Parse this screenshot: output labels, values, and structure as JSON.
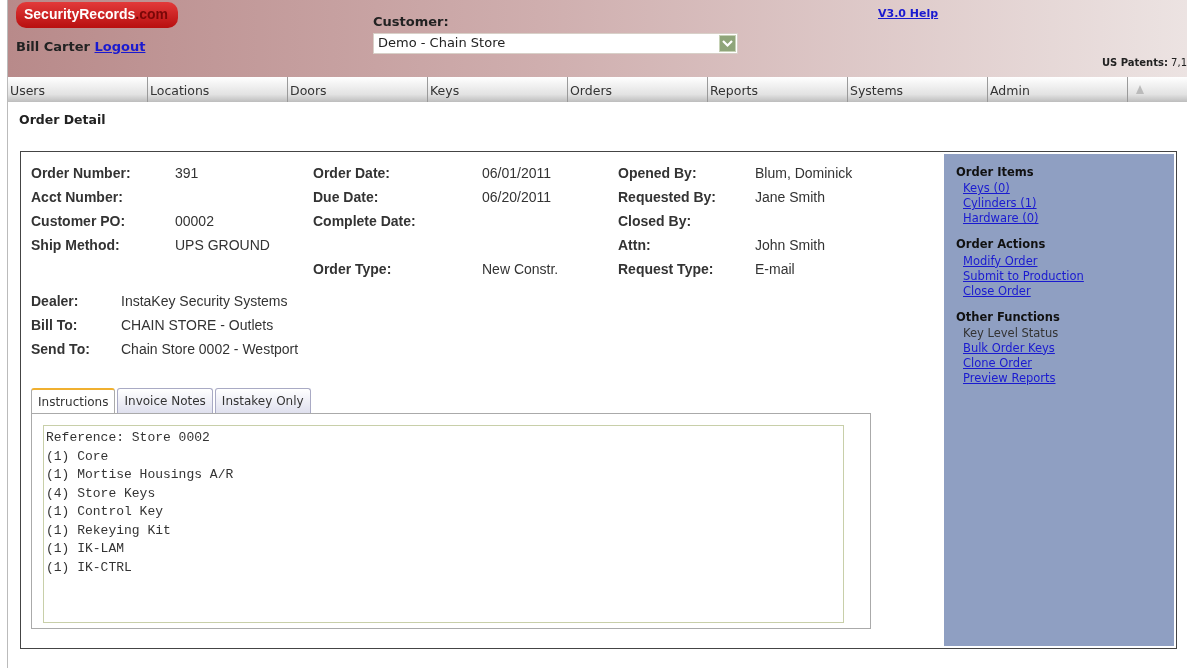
{
  "header": {
    "logo": {
      "name": "SecurityRecords",
      "suffix": ".com"
    },
    "user": "Bill Carter",
    "logout": "Logout",
    "customer_label": "Customer:",
    "customer_select": {
      "value": "Demo - Chain Store"
    },
    "help": "V3.0 Help",
    "patents_label": "US Patents:",
    "patents_value": "7,1"
  },
  "nav": [
    {
      "label": "Users"
    },
    {
      "label": "Locations"
    },
    {
      "label": "Doors"
    },
    {
      "label": "Keys"
    },
    {
      "label": "Orders"
    },
    {
      "label": "Reports"
    },
    {
      "label": "Systems"
    },
    {
      "label": "Admin"
    }
  ],
  "page_title": "Order Detail",
  "fields": [
    {
      "left": {
        "label": "Order Number:",
        "value": "391"
      },
      "middle": {
        "label": "Order Date:",
        "value": "06/01/2011"
      },
      "right": {
        "label": "Opened By:",
        "value": "Blum, Dominick"
      }
    },
    {
      "left": {
        "label": "Acct Number:"
      },
      "middle": {
        "label": "Due Date:",
        "value": "06/20/2011"
      },
      "right": {
        "label": "Requested By:",
        "value": "Jane Smith"
      }
    },
    {
      "left": {
        "label": "Customer PO:",
        "value": "00002"
      },
      "middle": {
        "label": "Complete Date:"
      },
      "right": {
        "label": "Closed By:"
      }
    },
    {
      "left": {
        "label": "Ship Method:",
        "value": "UPS GROUND"
      },
      "right": {
        "label": "Attn:",
        "value": "John Smith"
      }
    },
    {
      "middle": {
        "label": "Order Type:",
        "value": "New Constr."
      },
      "right": {
        "label": "Request Type:",
        "value": "E-mail"
      }
    }
  ],
  "parties": [
    {
      "label": "Dealer:",
      "value": "InstaKey Security Systems"
    },
    {
      "label": "Bill To:",
      "value": "CHAIN STORE - Outlets"
    },
    {
      "label": "Send To:",
      "value": "Chain Store 0002 - Westport"
    }
  ],
  "tabs": [
    {
      "label": "Instructions",
      "selected": true
    },
    {
      "label": "Invoice Notes",
      "selected": false
    },
    {
      "label": "Instakey Only",
      "selected": false
    }
  ],
  "instructions": [
    "Reference: Store 0002",
    "(1) Core",
    "(1) Mortise Housings A/R",
    "(4) Store Keys",
    "(1) Control Key",
    "(1) Rekeying Kit",
    "(1) IK-LAM",
    "(1) IK-CTRL"
  ],
  "sidebar": [
    {
      "title": "Order Items",
      "items": [
        {
          "label": "Keys (0)",
          "kind": "link"
        },
        {
          "label": "Cylinders (1)",
          "kind": "link"
        },
        {
          "label": "Hardware (0)",
          "kind": "link"
        }
      ]
    },
    {
      "title": "Order Actions",
      "items": [
        {
          "label": "Modify Order",
          "kind": "link"
        },
        {
          "label": "Submit to Production",
          "kind": "link"
        },
        {
          "label": "Close Order",
          "kind": "link"
        }
      ]
    },
    {
      "title": "Other Functions",
      "items": [
        {
          "label": "Key Level Status",
          "kind": "text"
        },
        {
          "label": "Bulk Order Keys",
          "kind": "link"
        },
        {
          "label": "Clone Order",
          "kind": "link"
        },
        {
          "label": "Preview Reports",
          "kind": "link"
        }
      ]
    }
  ]
}
